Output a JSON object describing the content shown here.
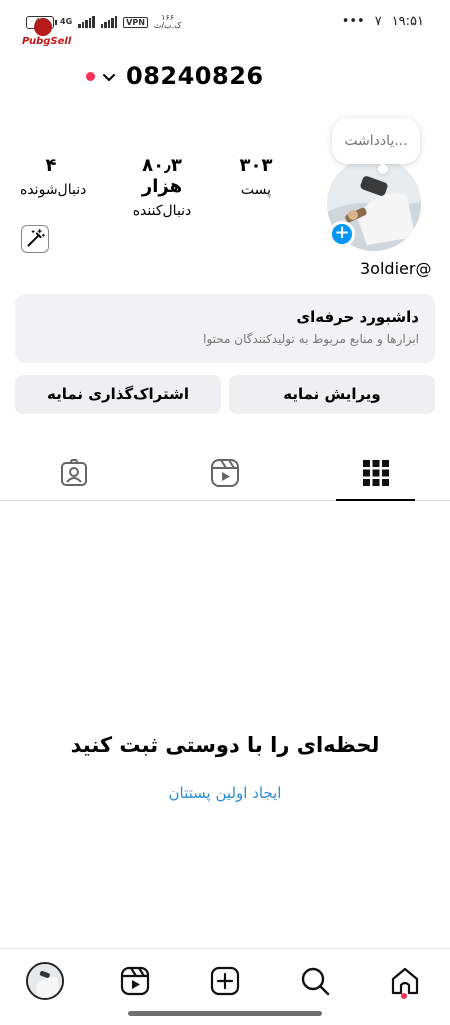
{
  "status_bar": {
    "battery": "48",
    "network": "4G",
    "vpn": "VPN",
    "speed_value": "۱۶۶",
    "speed_unit": "ک.ب/ث",
    "notification_glyph": "۷",
    "dots": "•••",
    "time": "۱۹:۵۱",
    "watermark": "PubgSell"
  },
  "header": {
    "username": "08240826",
    "live_indicator_color": "#ff2d55",
    "dropdown_icon": "chevron-down-icon"
  },
  "profile": {
    "note_placeholder": "یادداشت...",
    "handle": "3oldier@",
    "stats": [
      {
        "value": "۳۰۳",
        "label": "پست"
      },
      {
        "value": "۸۰٫۳ هزار",
        "label": "دنبال‌کننده"
      },
      {
        "value": "۴",
        "label": "دنبال‌شونده"
      }
    ],
    "add_icon": "plus-icon",
    "magic_icon": "magic-wand-icon"
  },
  "dashboard": {
    "title": "داشبورد حرفه‌ای",
    "subtitle": "ابزارها و منابع مربوط به تولیدکنندگان محتوا"
  },
  "actions": {
    "edit_profile": "ویرایش نمایه",
    "share_profile": "اشتراک‌گذاری نمایه"
  },
  "tabs": [
    {
      "icon": "grid-icon",
      "active": true
    },
    {
      "icon": "reels-icon",
      "active": false
    },
    {
      "icon": "tagged-icon",
      "active": false
    }
  ],
  "empty_state": {
    "title": "لحظه‌ای را با دوستی ثبت کنید",
    "link": "ایجاد اولین پستتان"
  },
  "bottom_nav": [
    {
      "icon": "home-icon",
      "active": true
    },
    {
      "icon": "search-icon"
    },
    {
      "icon": "create-icon"
    },
    {
      "icon": "reels-icon"
    },
    {
      "icon": "profile-avatar"
    }
  ],
  "colors": {
    "accent": "#0095f6",
    "link": "#2a8fd8",
    "notification": "#ff2d55"
  }
}
